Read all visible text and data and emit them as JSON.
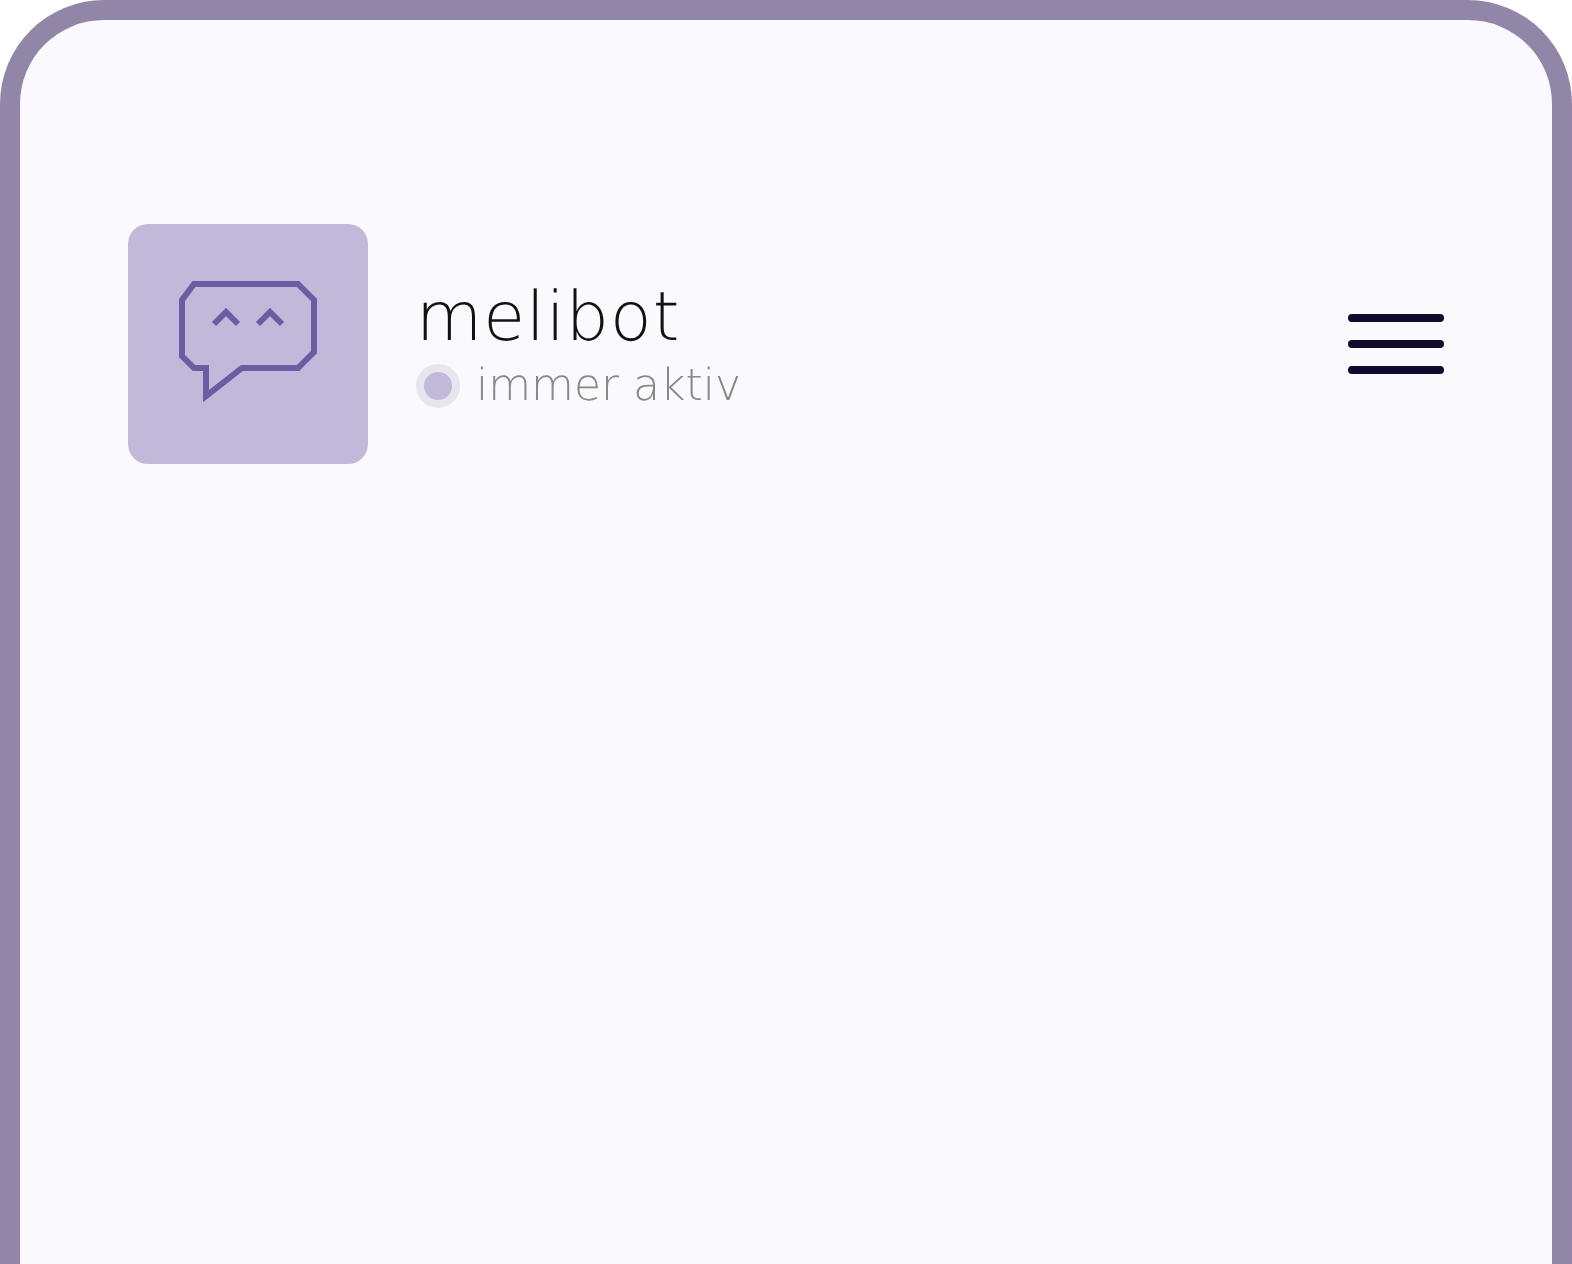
{
  "bot": {
    "name": "melibot",
    "status": {
      "label": "immer aktiv",
      "color": "#c2b9da"
    }
  }
}
